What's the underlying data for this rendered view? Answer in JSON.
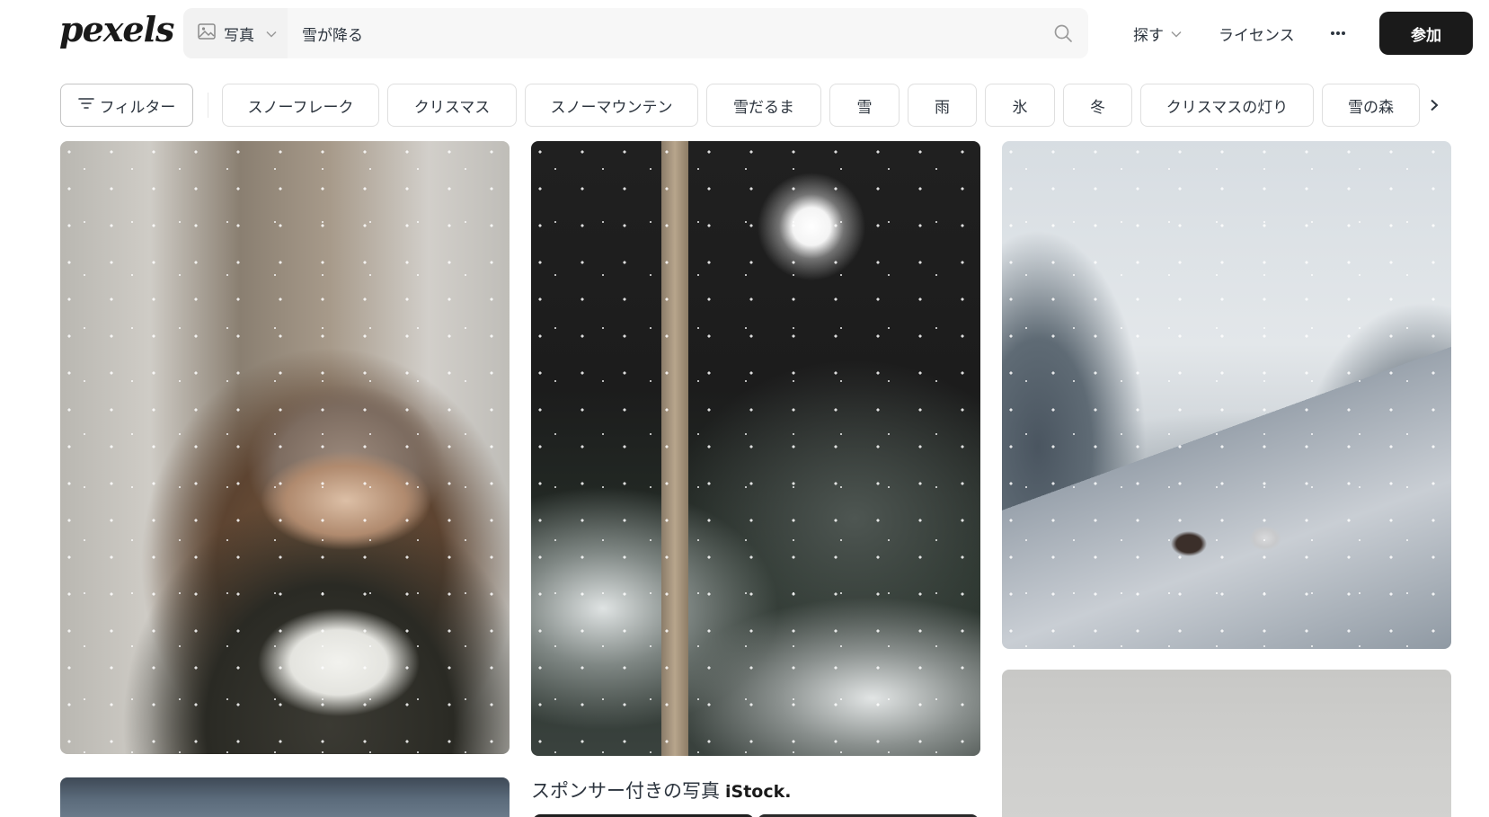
{
  "header": {
    "logo_text": "pexels",
    "search": {
      "type_label": "写真",
      "query": "雪が降る",
      "placeholder": ""
    },
    "nav": {
      "explore_label": "探す",
      "license_label": "ライセンス",
      "more_label": "···",
      "join_label": "参加"
    }
  },
  "filters": {
    "filter_label": "フィルター",
    "chips": [
      {
        "label": "スノーフレーク"
      },
      {
        "label": "クリスマス"
      },
      {
        "label": "スノーマウンテン"
      },
      {
        "label": "雪だるま"
      },
      {
        "label": "雪"
      },
      {
        "label": "雨"
      },
      {
        "label": "氷"
      },
      {
        "label": "冬"
      },
      {
        "label": "クリスマスの灯り"
      },
      {
        "label": "雪の森"
      }
    ]
  },
  "sponsored": {
    "label": "スポンサー付きの写真",
    "brand": "iStock."
  },
  "colors": {
    "join_button_bg": "#1a1a1a",
    "search_bg": "#f7f7f7",
    "chip_border": "#dfdfdf",
    "text": "#2c343e"
  },
  "icons": {
    "search_type": "image-icon",
    "search": "search-icon",
    "explore": "chevron-down-icon",
    "more": "more-dots-icon",
    "filter": "filter-lines-icon",
    "chips_next": "chevron-right-icon"
  }
}
